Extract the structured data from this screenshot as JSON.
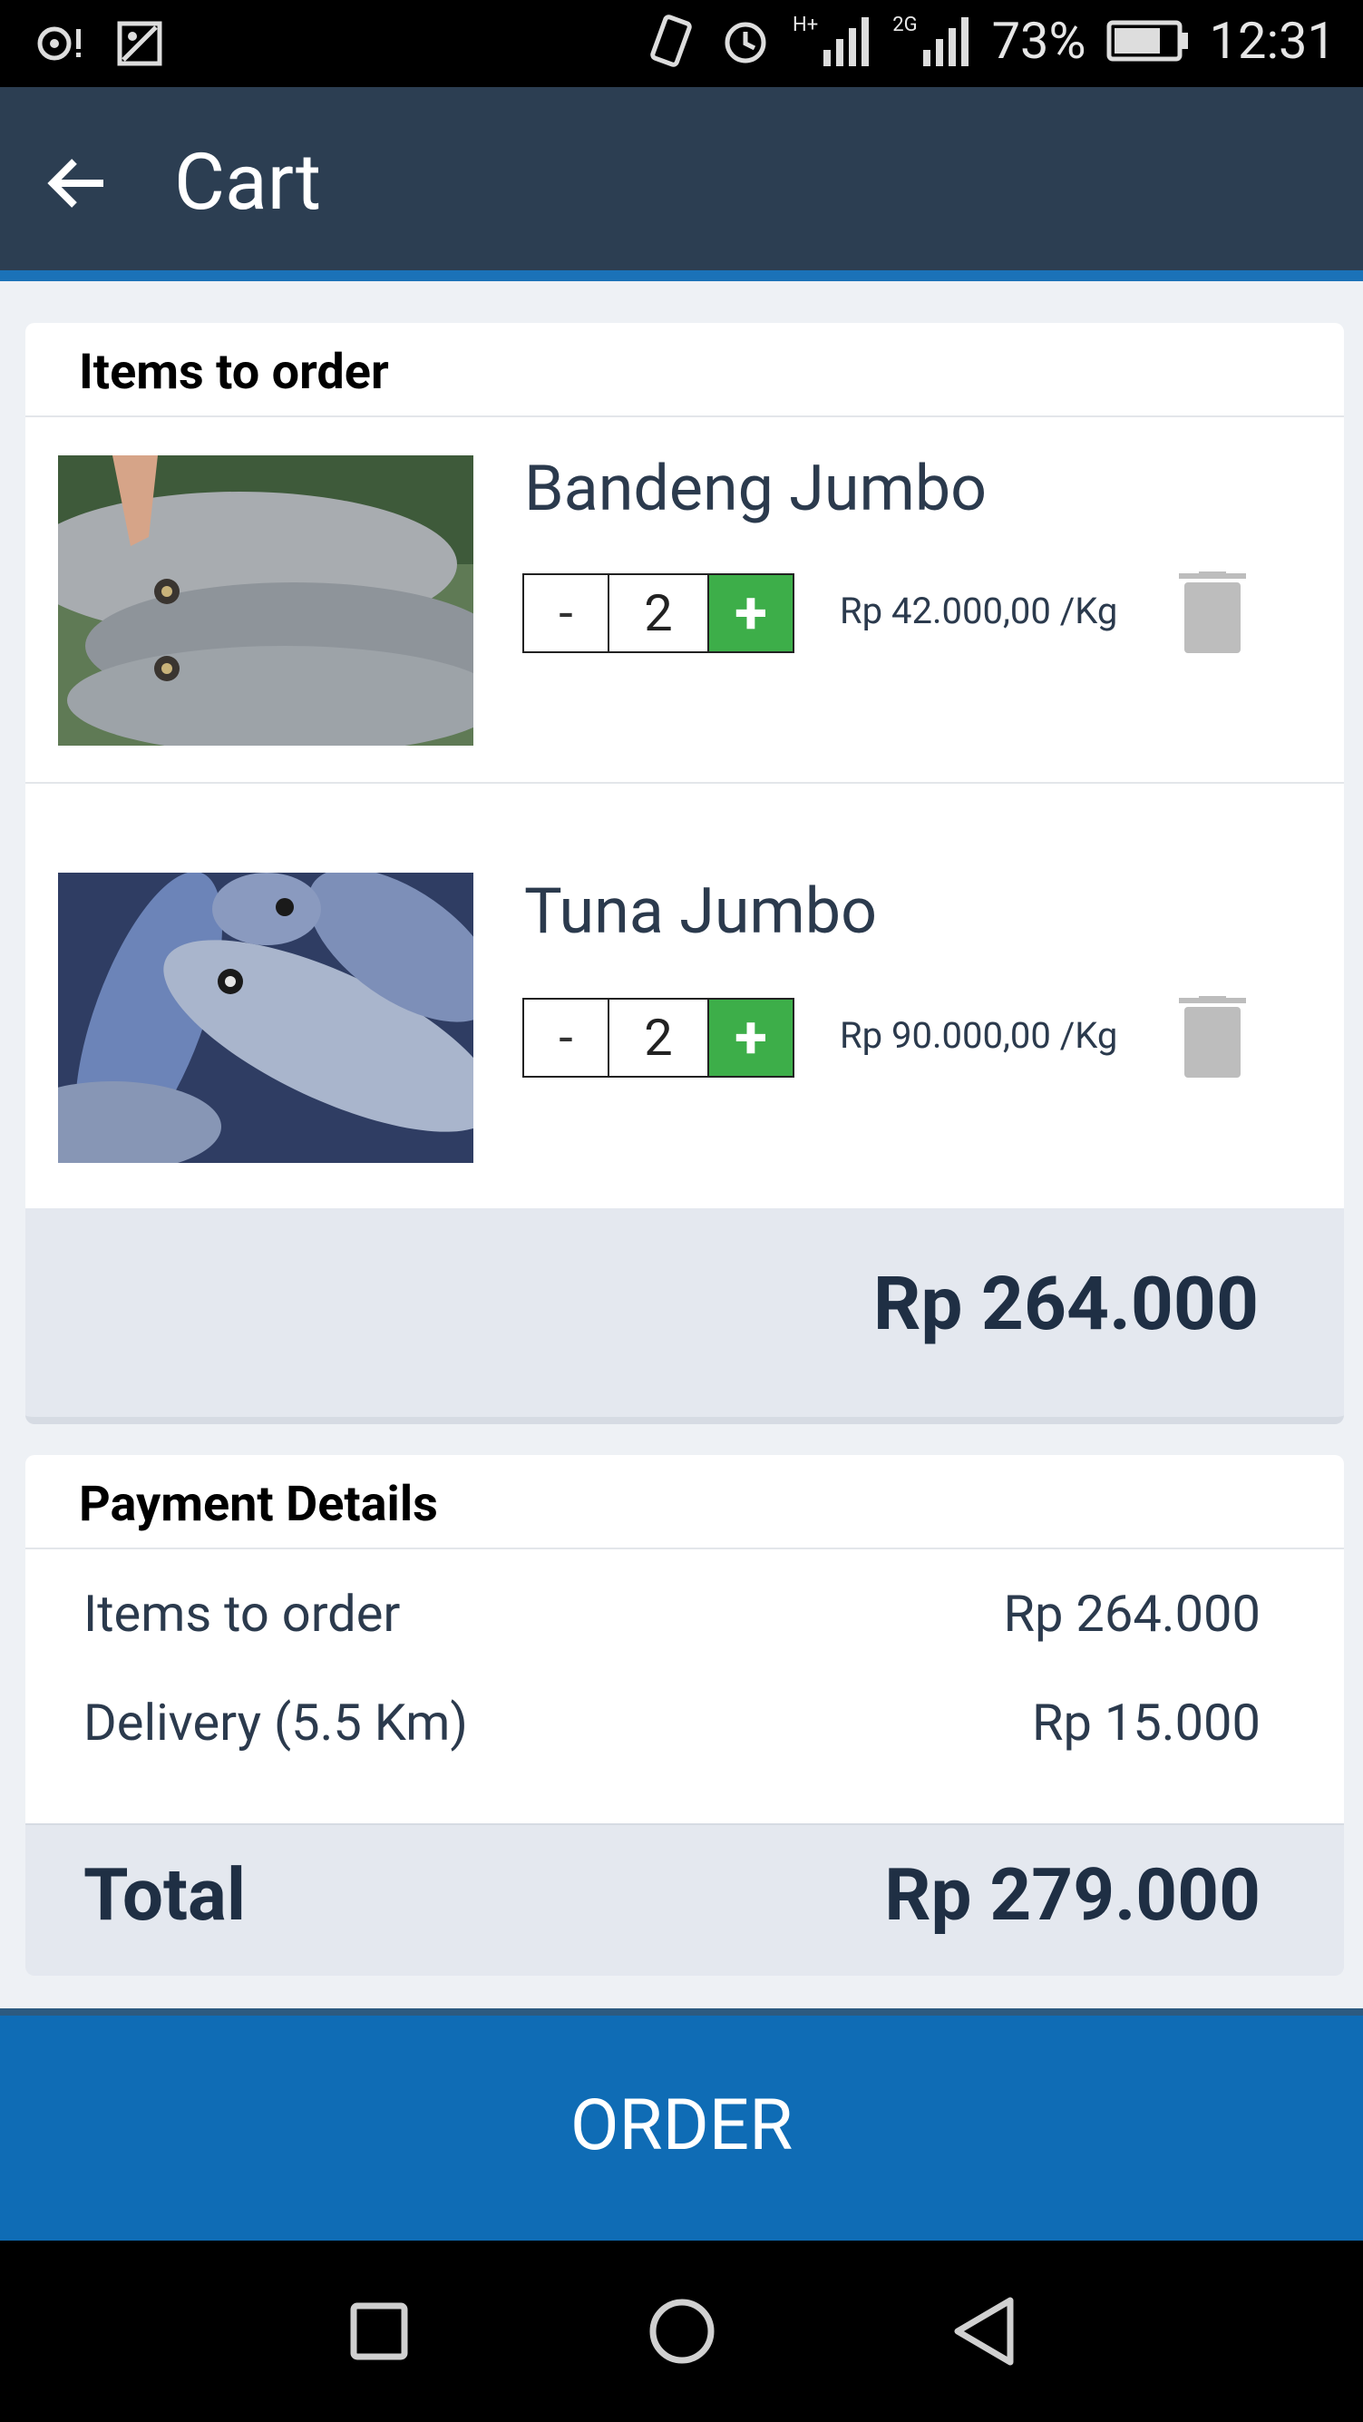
{
  "status_bar": {
    "battery": "73%",
    "time": "12:31",
    "network_1": "H+",
    "network_2": "2G"
  },
  "app_bar": {
    "title": "Cart"
  },
  "items_card": {
    "header": "Items to order",
    "items": [
      {
        "name": "Bandeng Jumbo",
        "quantity": "2",
        "minus": "-",
        "plus": "+",
        "price": "Rp 42.000,00 /Kg"
      },
      {
        "name": "Tuna Jumbo",
        "quantity": "2",
        "minus": "-",
        "plus": "+",
        "price": "Rp 90.000,00 /Kg"
      }
    ],
    "subtotal": "Rp 264.000"
  },
  "payment_card": {
    "header": "Payment Details",
    "rows": [
      {
        "label": "Items to order",
        "value": "Rp 264.000"
      },
      {
        "label": "Delivery (5.5 Km)",
        "value": "Rp 15.000"
      }
    ],
    "total_label": "Total",
    "total_value": "Rp 279.000"
  },
  "order_button": "ORDER",
  "colors": {
    "app_bar": "#2c3e52",
    "accent": "#1b72b8",
    "plus_button": "#3dae49",
    "order_button": "#0f6cb5"
  },
  "icons": {
    "back": "arrow-left-icon",
    "delete": "trash-icon",
    "nav_recent": "square-icon",
    "nav_home": "circle-icon",
    "nav_back": "triangle-back-icon"
  }
}
